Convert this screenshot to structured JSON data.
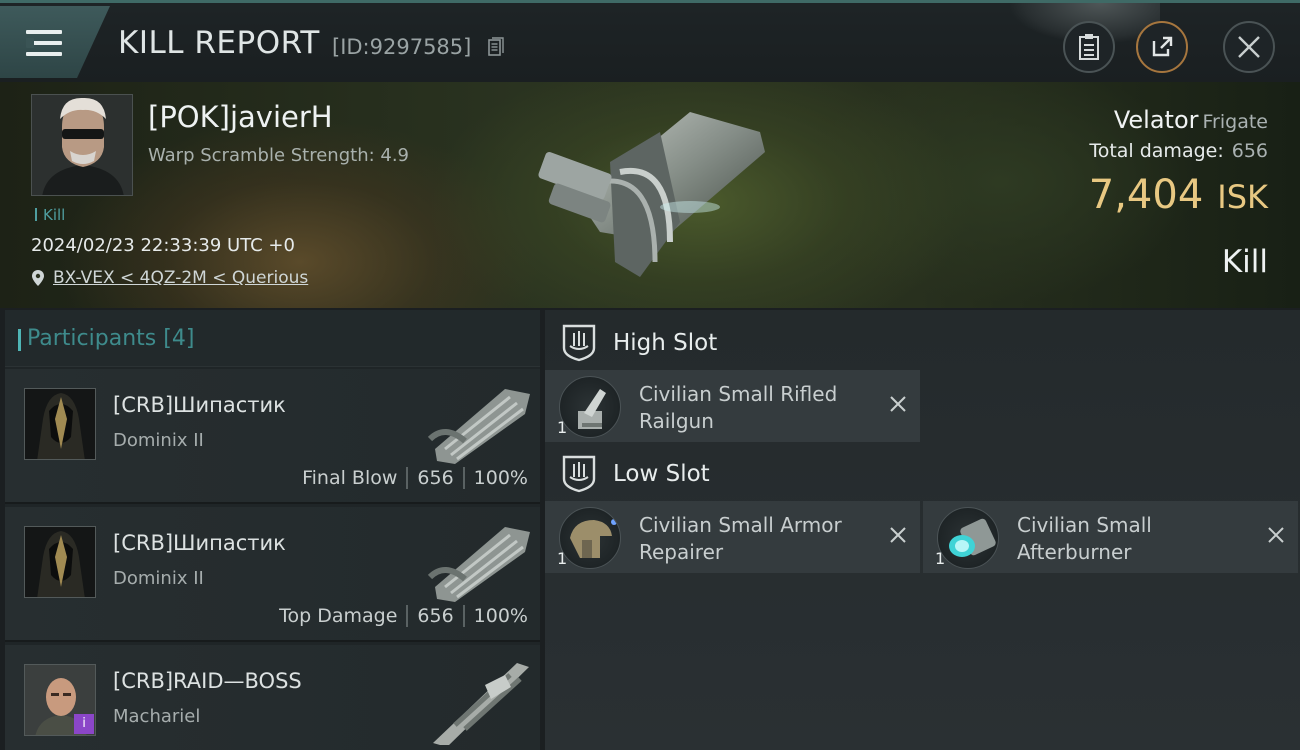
{
  "header": {
    "title": "KILL REPORT",
    "report_id": "[ID:9297585]"
  },
  "victim": {
    "name": "[POK]javierH",
    "warp_scramble": "Warp Scramble Strength: 4.9",
    "type_tag": "Kill",
    "timestamp": "2024/02/23 22:33:39 UTC +0",
    "location": "BX-VEX < 4QZ-2M < Querious",
    "ship": "Velator",
    "ship_class": "Frigate",
    "total_damage_label": "Total damage:",
    "total_damage": "656",
    "isk_value": "7,404",
    "isk_unit": "ISK",
    "result": "Kill"
  },
  "participants": {
    "title": "Participants",
    "count": "[4]",
    "rows": [
      {
        "name": "[CRB]Шипастик",
        "ship": "Dominix II",
        "role": "Final Blow",
        "damage": "656",
        "percent": "100%"
      },
      {
        "name": "[CRB]Шипастик",
        "ship": "Dominix II",
        "role": "Top Damage",
        "damage": "656",
        "percent": "100%"
      },
      {
        "name": "[CRB]RAID—BOSS",
        "ship": "Machariel",
        "badge": "i"
      }
    ]
  },
  "fitting": {
    "high_slot": {
      "title": "High Slot",
      "modules": [
        {
          "qty": "1",
          "name": "Civilian Small Rifled Railgun"
        }
      ]
    },
    "low_slot": {
      "title": "Low Slot",
      "modules": [
        {
          "qty": "1",
          "name": "Civilian Small Armor Repairer"
        },
        {
          "qty": "1",
          "name": "Civilian Small Afterburner"
        }
      ]
    }
  },
  "colors": {
    "accent_teal": "#4fb5b5",
    "isk_gold": "#e8c882",
    "badge_purple": "#8b46c8"
  },
  "icons": [
    "menu-icon",
    "copy-icon",
    "clipboard-icon",
    "share-icon",
    "close-icon",
    "location-pin-icon",
    "shield-slot-icon",
    "remove-x-icon"
  ]
}
